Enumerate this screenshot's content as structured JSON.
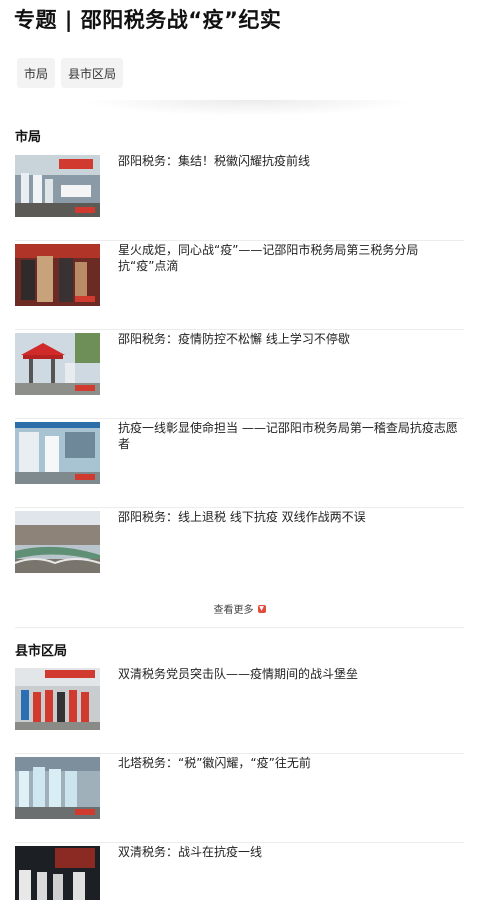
{
  "page": {
    "title": "专题 | 邵阳税务战“疫”纪实"
  },
  "tabs": [
    {
      "label": "市局"
    },
    {
      "label": "县市区局"
    }
  ],
  "sections": [
    {
      "title": "市局",
      "items": [
        {
          "title": "邵阳税务：集结！税徽闪耀抗疫前线"
        },
        {
          "title": "星火成炬，同心战“疫”——记邵阳市税务局第三税务分局抗“疫”点滴"
        },
        {
          "title": "邵阳税务：疫情防控不松懈 线上学习不停歇"
        },
        {
          "title": "抗疫一线彰显使命担当 ——记邵阳市税务局第一稽查局抗疫志愿者"
        },
        {
          "title": "邵阳税务：线上退税 线下抗疫 双线作战两不误"
        }
      ],
      "more_label": "查看更多"
    },
    {
      "title": "县市区局",
      "items": [
        {
          "title": "双清税务党员突击队——疫情期间的战斗堡垒"
        },
        {
          "title": "北塔税务：“税”徽闪耀，“疫”往无前"
        },
        {
          "title": "双清税务：战斗在抗疫一线"
        }
      ]
    }
  ],
  "colors": {
    "accent": "#e34b3a",
    "divider": "#ececec",
    "tab_bg": "#f3f3f3"
  }
}
